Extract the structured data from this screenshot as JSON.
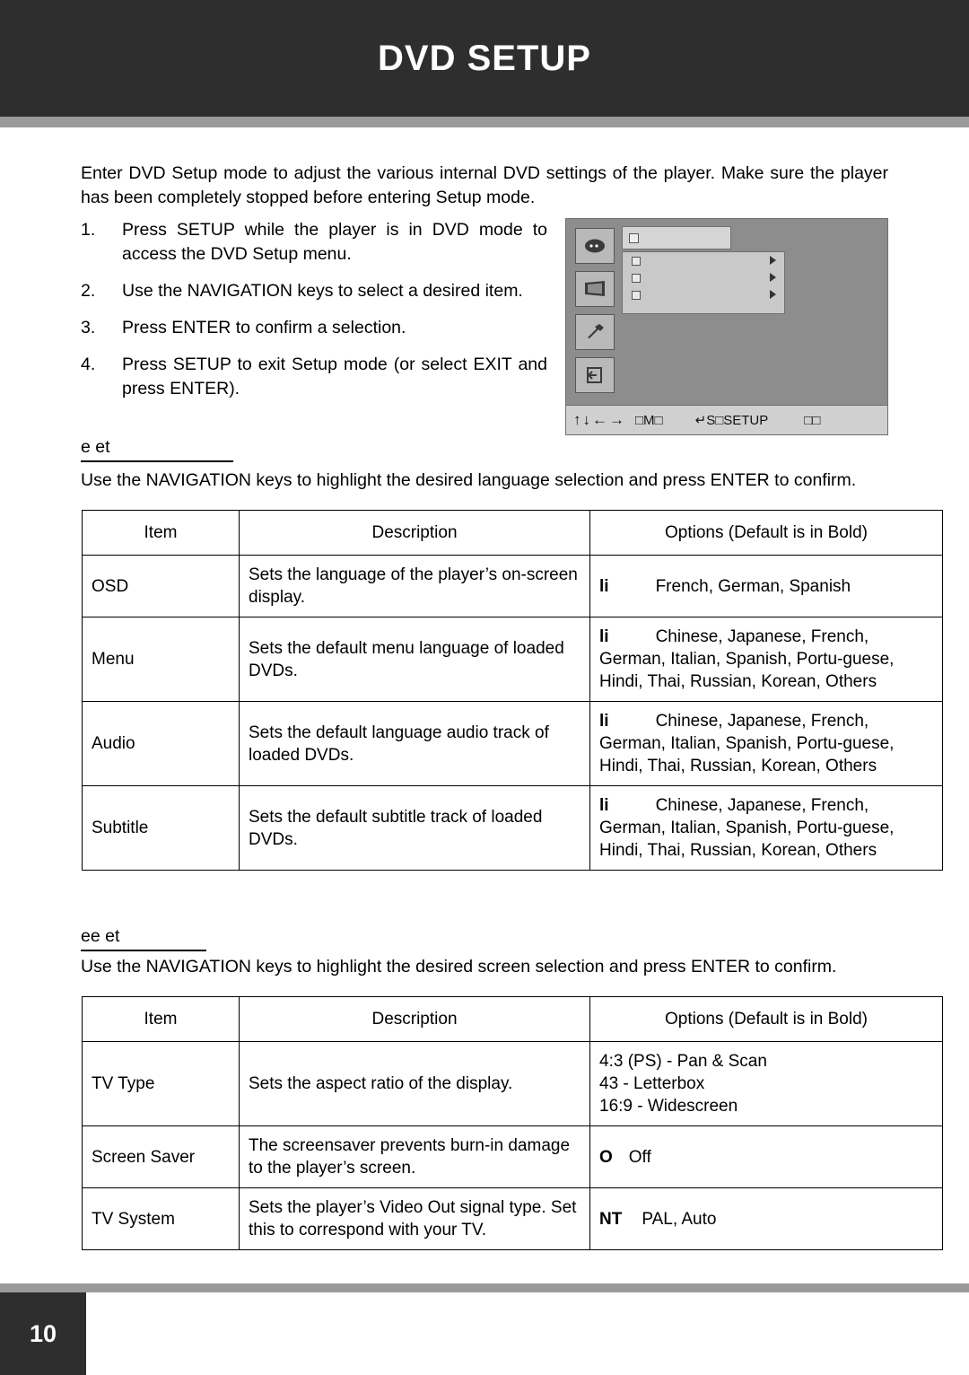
{
  "header": {
    "title": "DVD SETUP"
  },
  "intro": "Enter DVD Setup mode to adjust the various internal DVD settings of the player. Make sure the player has been completely stopped before entering Setup mode.",
  "steps": [
    {
      "num": "1.",
      "text": "Press SETUP while the player is in DVD mode to access the DVD Setup menu."
    },
    {
      "num": "2.",
      "text": "Use the NAVIGATION keys to select a desired item."
    },
    {
      "num": "3.",
      "text": "Press ENTER to confirm a selection."
    },
    {
      "num": "4.",
      "text": "Press SETUP to exit Setup mode (or select EXIT and press ENTER)."
    }
  ],
  "osd": {
    "nav_arrows": "↑↓←→",
    "seg1": "□M□",
    "seg2": "↵S□SETUP",
    "seg3": "□□"
  },
  "language_section": {
    "heading": "e et",
    "note": "Use the NAVIGATION keys to highlight the desired language selection and press ENTER to confirm.",
    "headers": [
      "Item",
      "Description",
      "Options (Default is in Bold)"
    ],
    "rows": [
      {
        "item": "OSD",
        "description": "Sets the language of the player’s on-screen display.",
        "options_bold": "li",
        "options_rest": "French, German, Spanish"
      },
      {
        "item": "Menu",
        "description": "Sets the default menu language of loaded DVDs.",
        "options_bold": "li",
        "options_rest": "Chinese, Japanese, French, German, Italian, Spanish, Portu-guese, Hindi, Thai, Russian, Korean, Others"
      },
      {
        "item": "Audio",
        "description": "Sets the default language audio track of loaded DVDs.",
        "options_bold": "li",
        "options_rest": "Chinese, Japanese, French, German, Italian, Spanish, Portu-guese, Hindi, Thai, Russian, Korean, Others"
      },
      {
        "item": "Subtitle",
        "description": "Sets the default subtitle track of loaded DVDs.",
        "options_bold": "li",
        "options_rest": "Chinese, Japanese, French, German, Italian, Spanish, Portu-guese, Hindi, Thai, Russian, Korean, Others"
      }
    ]
  },
  "screen_section": {
    "heading": "ee et",
    "note": "Use the NAVIGATION keys to highlight the desired screen selection and press ENTER to confirm.",
    "headers": [
      "Item",
      "Description",
      "Options (Default is in Bold)"
    ],
    "rows": [
      {
        "item": "TV Type",
        "description": "Sets the aspect ratio of the display.",
        "options_bold": "",
        "options_rest": "4:3 (PS) - Pan & Scan\n43          - Letterbox\n16:9 - Widescreen"
      },
      {
        "item": "Screen Saver",
        "description": "The screensaver prevents burn-in damage to the player’s screen.",
        "options_bold": "O",
        "options_rest": "Off"
      },
      {
        "item": "TV System",
        "description": "Sets the player’s Video Out signal type. Set this to correspond with your TV.",
        "options_bold": "NT",
        "options_rest": "PAL, Auto"
      }
    ]
  },
  "footer": {
    "page_number": "10"
  }
}
